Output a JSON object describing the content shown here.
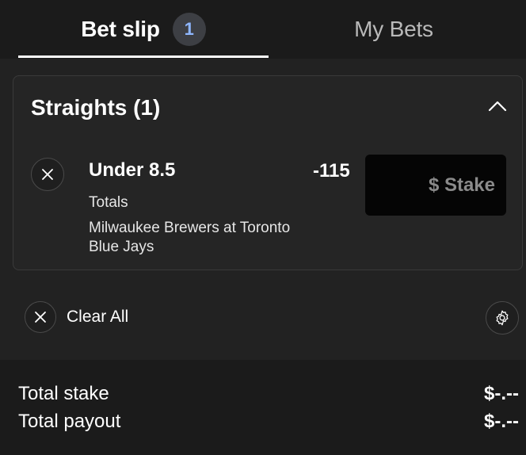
{
  "tabs": {
    "bet_slip": {
      "label": "Bet slip",
      "badge": "1"
    },
    "my_bets": {
      "label": "My Bets"
    }
  },
  "straights": {
    "title": "Straights (1)",
    "bet": {
      "selection": "Under 8.5",
      "odds": "-115",
      "market": "Totals",
      "event": "Milwaukee Brewers at Toronto Blue Jays",
      "stake_placeholder": "$ Stake",
      "stake_value": ""
    }
  },
  "actions": {
    "clear_all": "Clear All"
  },
  "totals": {
    "stake_label": "Total stake",
    "stake_value": "$-.--",
    "payout_label": "Total payout",
    "payout_value": "$-.--"
  },
  "icons": {
    "collapse": "chevron-up-icon",
    "remove": "close-icon",
    "clear": "close-icon",
    "settings": "gear-icon"
  },
  "colors": {
    "background": "#1b1b1b",
    "card": "#252525",
    "badge": "#3d3f44",
    "badge_text": "#8fb7ff",
    "stake_input": "#050505"
  }
}
